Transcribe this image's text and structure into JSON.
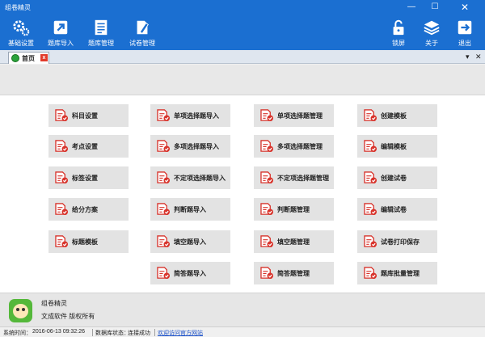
{
  "window": {
    "title": "组卷精灵",
    "min_glyph": "—",
    "max_glyph": "☐",
    "close_glyph": "✕"
  },
  "toolbar": {
    "basic_settings": "基础设置",
    "bank_import": "题库导入",
    "bank_manage": "题库管理",
    "paper_manage": "试卷管理",
    "lock": "锁屏",
    "about": "关于",
    "exit": "退出"
  },
  "tabs": {
    "home": "首页",
    "close_glyph": "x",
    "dropdown_glyph": "▾",
    "close_all_glyph": "✕"
  },
  "grid": {
    "subject_settings": "科目设置",
    "point_settings": "考点设置",
    "tag_settings": "标签设置",
    "scoring_scheme": "给分方案",
    "title_template": "标题模板",
    "single_choice_import": "单项选择题导入",
    "multi_choice_import": "多项选择题导入",
    "indef_choice_import": "不定项选择题导入",
    "judge_import": "判断题导入",
    "fill_import": "填空题导入",
    "short_answer_import": "简答题导入",
    "single_choice_manage": "单项选择题管理",
    "multi_choice_manage": "多项选择题管理",
    "indef_choice_manage": "不定项选择题管理",
    "judge_manage": "判断题管理",
    "fill_manage": "填空题管理",
    "short_answer_manage": "简答题管理",
    "create_template": "创建模板",
    "edit_template": "编辑模板",
    "create_paper": "创建试卷",
    "edit_paper": "编辑试卷",
    "print_save_paper": "试卷打印保存",
    "batch_manage": "题库批量管理"
  },
  "footer": {
    "product": "组卷精灵",
    "copyright": "文成软件  版权所有"
  },
  "status": {
    "time_label": "系统时间：",
    "time_value": "2016-06-13 09:32:26",
    "db_label": "数据库状态：",
    "db_value": "连接成功",
    "website_link": "欢迎访问官方网站"
  },
  "colors": {
    "chrome": "#1b6fd1",
    "button": "#e3e3e3",
    "icon_red": "#d8332b"
  }
}
